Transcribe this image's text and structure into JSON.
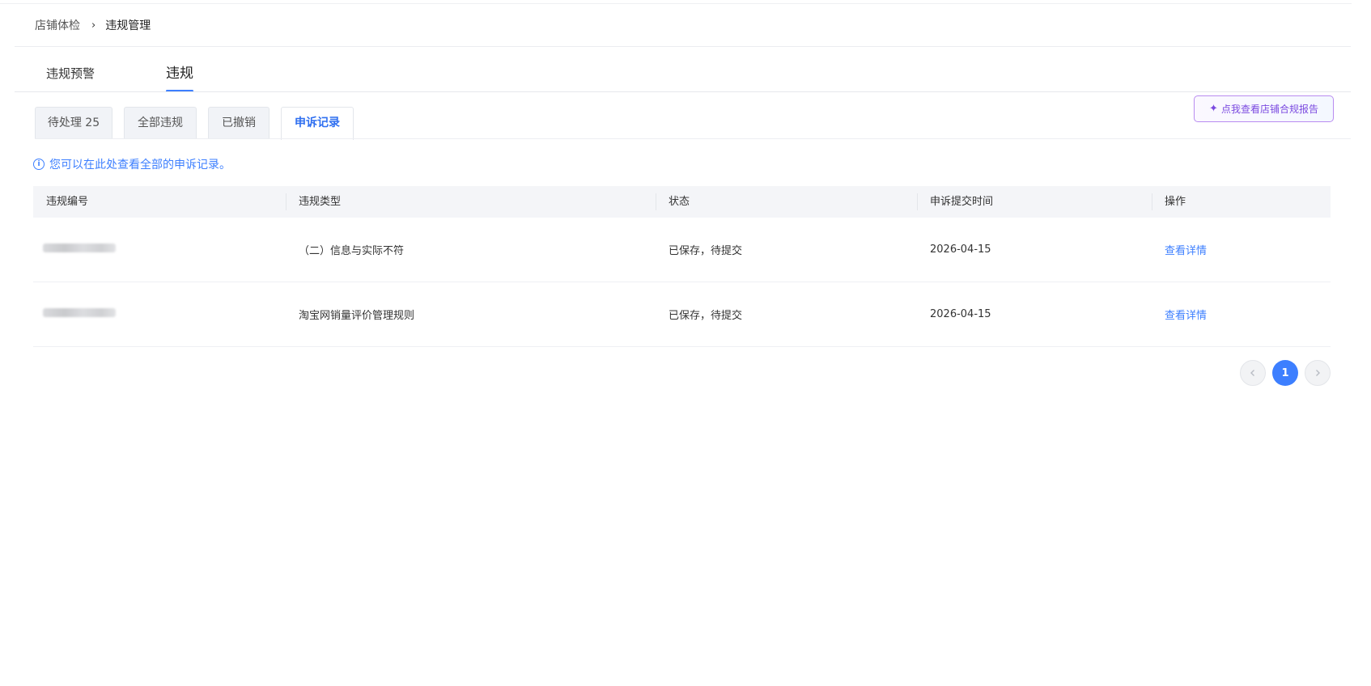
{
  "breadcrumb": {
    "items": [
      "店铺体检",
      "违规管理"
    ],
    "separator": "›"
  },
  "main_tabs": [
    {
      "label": "违规预警",
      "active": false
    },
    {
      "label": "违规",
      "active": true
    }
  ],
  "sub_tabs": [
    {
      "label": "待处理 25",
      "active": false
    },
    {
      "label": "全部违规",
      "active": false
    },
    {
      "label": "已撤销",
      "active": false
    },
    {
      "label": "申诉记录",
      "active": true
    }
  ],
  "report_button": {
    "label": "点我查看店铺合规报告",
    "icon": "sparkle-icon"
  },
  "notice": {
    "text": "您可以在此处查看全部的申诉记录。",
    "icon": "info-icon"
  },
  "table": {
    "columns": [
      "违规编号",
      "违规类型",
      "状态",
      "申诉提交时间",
      "操作"
    ],
    "rows": [
      {
        "type": "（二）信息与实际不符",
        "status": "已保存，待提交",
        "time": "2026-04-15",
        "action": "查看详情"
      },
      {
        "type": "淘宝网销量评价管理规则",
        "status": "已保存，待提交",
        "time": "2026-04-15",
        "action": "查看详情"
      }
    ]
  },
  "pagination": {
    "current_page": "1"
  },
  "colors": {
    "accent": "#3d7fff",
    "report_border": "#b98cf0",
    "report_text": "#7b4ae0"
  }
}
